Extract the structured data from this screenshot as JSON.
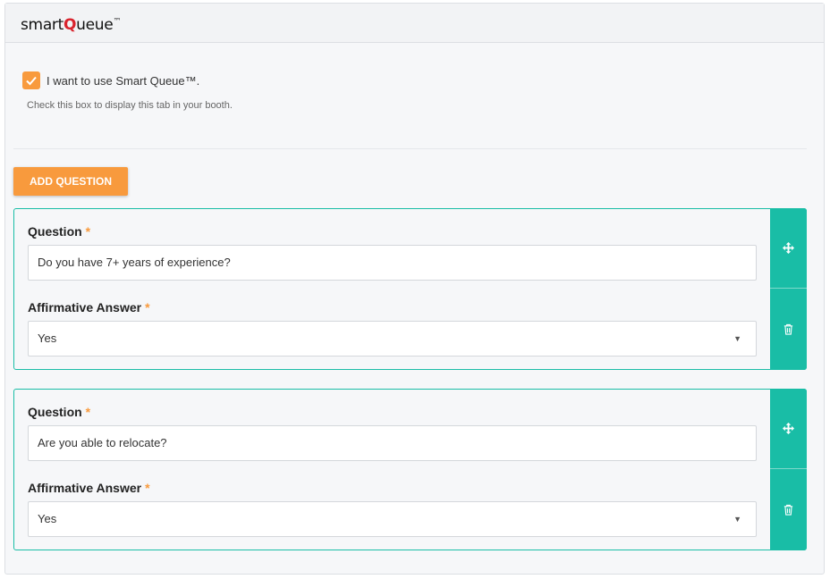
{
  "header": {
    "logo_pre": "smart",
    "logo_q": "Q",
    "logo_post": "ueue",
    "logo_tm": "™"
  },
  "option": {
    "checked": true,
    "label": "I want to use Smart Queue™.",
    "help": "Check this box to display this tab in your booth."
  },
  "add_button_label": "ADD QUESTION",
  "questions": [
    {
      "question_label": "Question",
      "question_value": "Do you have 7+ years of experience?",
      "answer_label": "Affirmative Answer",
      "answer_value": "Yes"
    },
    {
      "question_label": "Question",
      "question_value": "Are you able to relocate?",
      "answer_label": "Affirmative Answer",
      "answer_value": "Yes"
    }
  ],
  "required_marker": "*",
  "colors": {
    "accent_orange": "#f89a3d",
    "accent_teal": "#19bda6",
    "logo_red": "#d9232d"
  },
  "icons": {
    "move": "move-arrows-icon",
    "delete": "trash-icon",
    "dropdown": "caret-down-icon",
    "check": "check-icon"
  }
}
